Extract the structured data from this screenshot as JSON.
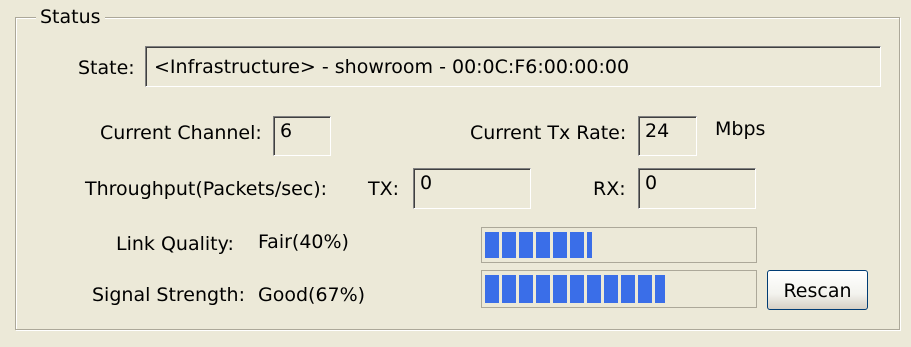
{
  "status_group": {
    "title": "Status",
    "state": {
      "label": "State:",
      "value": "<Infrastructure> - showroom - 00:0C:F6:00:00:00"
    },
    "current_channel": {
      "label": "Current Channel:",
      "value": "6"
    },
    "current_tx_rate": {
      "label": "Current Tx Rate:",
      "value": "24",
      "unit": "Mbps"
    },
    "throughput": {
      "label": "Throughput(Packets/sec):",
      "tx_label": "TX:",
      "tx_value": "0",
      "rx_label": "RX:",
      "rx_value": "0"
    },
    "link_quality": {
      "label": "Link Quality:",
      "value": "Fair(40%)",
      "percent": 40
    },
    "signal_strength": {
      "label": "Signal Strength:",
      "value": "Good(67%)",
      "percent": 67
    },
    "rescan_label": "Rescan",
    "colors": {
      "progress_fill": "#3A6EE8",
      "background": "#ECE9D8"
    }
  }
}
